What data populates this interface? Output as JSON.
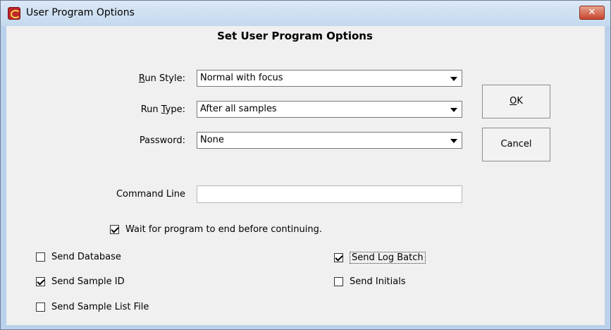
{
  "window": {
    "title": "User Program Options"
  },
  "dialog": {
    "heading": "Set User Program Options",
    "fields": {
      "run_style": {
        "label_prefix": "",
        "label_mnemonic": "R",
        "label_rest": "un Style:",
        "value": "Normal with focus"
      },
      "run_type": {
        "label_prefix": "Run ",
        "label_mnemonic": "T",
        "label_rest": "ype:",
        "value": "After all samples"
      },
      "password": {
        "label": "Password:",
        "value": "None"
      },
      "command_line": {
        "label": "Command Line",
        "value": ""
      }
    },
    "buttons": {
      "ok": {
        "mnemonic": "O",
        "rest": "K"
      },
      "cancel": "Cancel"
    },
    "checkboxes": {
      "wait": {
        "label": "Wait for program to end before continuing.",
        "checked": true
      },
      "send_database": {
        "label": "Send Database",
        "checked": false
      },
      "send_sample_id": {
        "label": "Send Sample ID",
        "checked": true
      },
      "send_sample_list_file": {
        "label": "Send Sample List File",
        "checked": false
      },
      "send_log_batch": {
        "label": "Send Log Batch",
        "checked": true
      },
      "send_initials": {
        "label": "Send Initials",
        "checked": false
      }
    }
  },
  "colors": {
    "titlebar": "#c4d9ee",
    "close": "#c7452e",
    "client": "#f0f0f0"
  },
  "icons": {
    "app": "app-logo-icon",
    "close": "close-icon",
    "dropdown": "chevron-down-icon"
  }
}
